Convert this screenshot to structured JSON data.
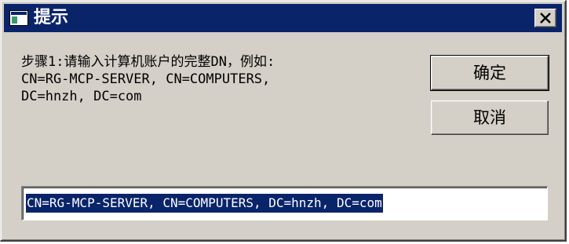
{
  "dialog": {
    "title": "提示",
    "icon": "window-icon",
    "prompt_lines": [
      "步骤1:请输入计算机账户的完整DN，例如:",
      "CN=RG-MCP-SERVER, CN=COMPUTERS,",
      "DC=hnzh, DC=com"
    ],
    "ok_label": "确定",
    "cancel_label": "取消",
    "input_value": "CN=RG-MCP-SERVER, CN=COMPUTERS, DC=hnzh, DC=com",
    "colors": {
      "titlebar": "#0a246a",
      "face": "#d4d0c8",
      "selection": "#0a246a"
    }
  }
}
